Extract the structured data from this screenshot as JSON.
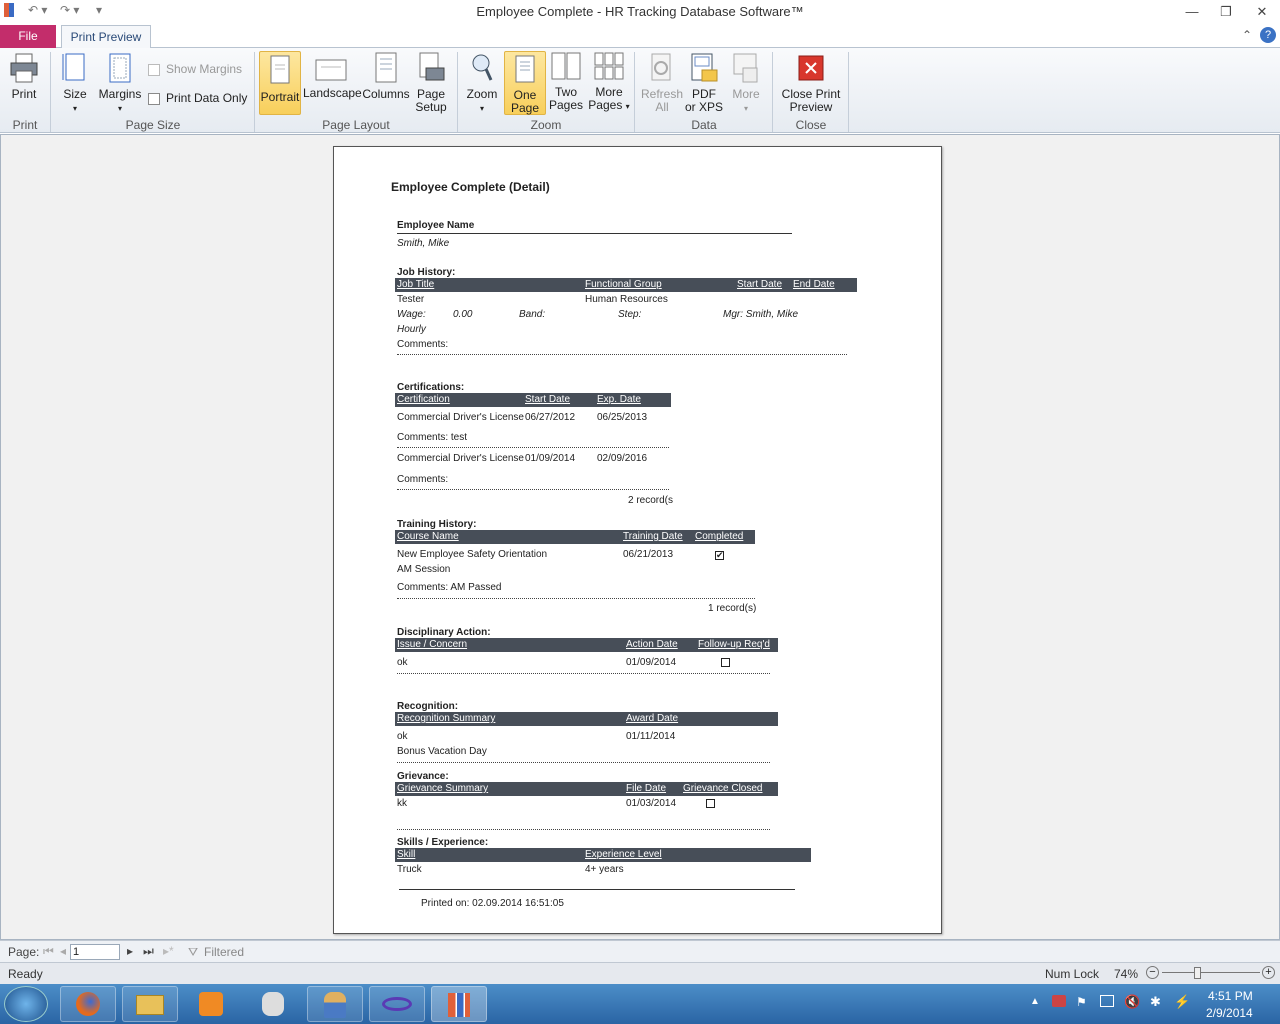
{
  "window": {
    "title": "Employee Complete  -  HR Tracking Database Software™"
  },
  "tabs": {
    "file": "File",
    "print_preview": "Print Preview"
  },
  "ribbon": {
    "print": {
      "label": "Print",
      "group": "Print"
    },
    "page_size": {
      "size": "Size",
      "margins": "Margins",
      "show_margins": "Show Margins",
      "print_data_only": "Print Data Only",
      "group": "Page Size"
    },
    "page_layout": {
      "portrait": "Portrait",
      "landscape": "Landscape",
      "columns": "Columns",
      "page_setup_1": "Page",
      "page_setup_2": "Setup",
      "group": "Page Layout"
    },
    "zoom": {
      "zoom": "Zoom",
      "one_page_1": "One",
      "one_page_2": "Page",
      "two_pages_1": "Two",
      "two_pages_2": "Pages",
      "more_pages_1": "More",
      "more_pages_2": "Pages",
      "group": "Zoom"
    },
    "data": {
      "refresh_1": "Refresh",
      "refresh_2": "All",
      "pdf_1": "PDF",
      "pdf_2": "or XPS",
      "more": "More",
      "group": "Data"
    },
    "close": {
      "label_1": "Close Print",
      "label_2": "Preview",
      "group": "Close Preview"
    }
  },
  "report": {
    "title": "Employee Complete (Detail)",
    "employee_name_label": "Employee Name",
    "employee_name": "Smith, Mike",
    "job_history": {
      "heading": "Job History:",
      "cols": [
        "Job Title",
        "Functional Group",
        "Start Date",
        "End Date"
      ],
      "job_title": "Tester",
      "functional_group": "Human Resources",
      "wage_label": "Wage:",
      "wage": "0.00",
      "band_label": "Band:",
      "step_label": "Step:",
      "mgr": "Mgr: Smith, Mike",
      "pay_type": "Hourly",
      "comments": "Comments:"
    },
    "certifications": {
      "heading": "Certifications:",
      "cols": [
        "Certification",
        "Start Date",
        "Exp. Date"
      ],
      "rows": [
        {
          "name": "Commercial Driver's License",
          "start": "06/27/2012",
          "exp": "06/25/2013",
          "comments": "Comments: test"
        },
        {
          "name": "Commercial Driver's License",
          "start": "01/09/2014",
          "exp": "02/09/2016",
          "comments": "Comments:"
        }
      ],
      "count": "2 record(s"
    },
    "training": {
      "heading": "Training History:",
      "cols": [
        "Course Name",
        "Training Date",
        "Completed"
      ],
      "course": "New Employee Safety Orientation",
      "session": "AM Session",
      "date": "06/21/2013",
      "comments": "Comments: AM Passed",
      "count": "1 record(s)"
    },
    "disciplinary": {
      "heading": "Disciplinary Action:",
      "cols": [
        "Issue / Concern",
        "Action Date",
        "Follow-up Req'd"
      ],
      "issue": "ok",
      "date": "01/09/2014"
    },
    "recognition": {
      "heading": "Recognition:",
      "cols": [
        "Recognition Summary",
        "Award Date"
      ],
      "summary": "ok",
      "detail": "Bonus Vacation Day",
      "date": "01/11/2014"
    },
    "grievance": {
      "heading": "Grievance:",
      "cols": [
        "Grievance Summary",
        "File Date",
        "Grievance Closed"
      ],
      "summary": "kk",
      "date": "01/03/2014"
    },
    "skills": {
      "heading": "Skills / Experience:",
      "cols": [
        "Skill",
        "Experience Level"
      ],
      "skill": "Truck",
      "level": "4+ years"
    },
    "printed_on": "Printed on: 02.09.2014 16:51:05"
  },
  "nav": {
    "page_label": "Page:",
    "page_value": "1",
    "filtered": "Filtered"
  },
  "status": {
    "ready": "Ready",
    "num_lock": "Num Lock",
    "zoom": "74%",
    "zoom_level_percent": 74
  },
  "taskbar": {
    "time": "4:51 PM",
    "date": "2/9/2014"
  }
}
